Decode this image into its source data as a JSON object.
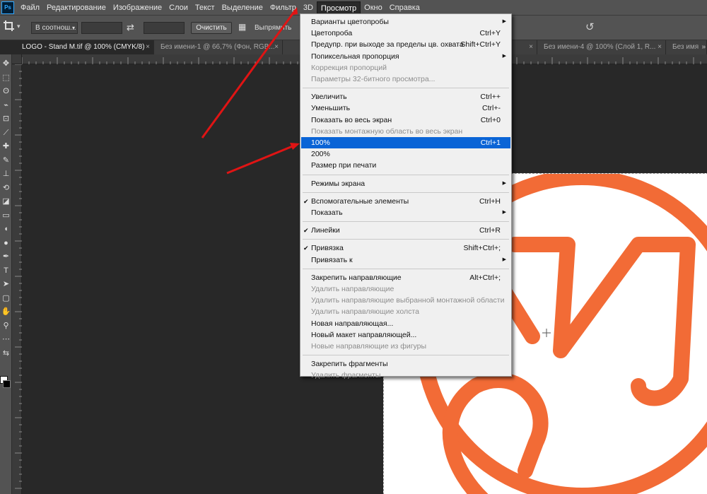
{
  "colors": {
    "menu_highlight": "#0a64d6",
    "logo_orange": "#f26b36",
    "annotation_arrow": "#e01414"
  },
  "menubar": {
    "app_icon": "Ps",
    "items": [
      "Файл",
      "Редактирование",
      "Изображение",
      "Слои",
      "Текст",
      "Выделение",
      "Фильтр",
      "3D",
      "Просмотр",
      "Окно",
      "Справка"
    ],
    "active_index": 8
  },
  "options_bar": {
    "tool_icon": "crop-icon",
    "ratio_value": "В соотнош...",
    "width_value": "",
    "height_value": "",
    "clear_label": "Очистить",
    "straighten_label": "Выпрямить",
    "reset_icon": "reset-icon"
  },
  "tabs": [
    {
      "label": "LOGO - Stand M.tif @ 100% (CMYK/8)",
      "active": true
    },
    {
      "label": "Без имени-1 @ 66,7% (Фон, RGB...",
      "active": false
    },
    {
      "label": "",
      "active": false
    },
    {
      "label": "",
      "active": false
    },
    {
      "label": "Без имени-4 @ 100% (Слой 1, R...",
      "active": false
    },
    {
      "label": "Без имя",
      "active": false
    }
  ],
  "tabs_scroll_icon": "double-chevron-right-icon",
  "view_menu": {
    "groups": [
      [
        {
          "label": "Варианты цветопробы",
          "shortcut": "",
          "submenu": true,
          "disabled": false,
          "checked": false
        },
        {
          "label": "Цветопроба",
          "shortcut": "Ctrl+Y",
          "submenu": false,
          "disabled": false,
          "checked": false
        },
        {
          "label": "Предупр. при выходе за пределы цв. охвата",
          "shortcut": "Shift+Ctrl+Y",
          "submenu": false,
          "disabled": false,
          "checked": false
        },
        {
          "label": "Попиксельная пропорция",
          "shortcut": "",
          "submenu": true,
          "disabled": false,
          "checked": false
        },
        {
          "label": "Коррекция пропорций",
          "shortcut": "",
          "submenu": false,
          "disabled": true,
          "checked": false
        },
        {
          "label": "Параметры 32-битного просмотра...",
          "shortcut": "",
          "submenu": false,
          "disabled": true,
          "checked": false
        }
      ],
      [
        {
          "label": "Увеличить",
          "shortcut": "Ctrl++",
          "submenu": false,
          "disabled": false,
          "checked": false
        },
        {
          "label": "Уменьшить",
          "shortcut": "Ctrl+-",
          "submenu": false,
          "disabled": false,
          "checked": false
        },
        {
          "label": "Показать во весь экран",
          "shortcut": "Ctrl+0",
          "submenu": false,
          "disabled": false,
          "checked": false
        },
        {
          "label": "Показать монтажную область во весь экран",
          "shortcut": "",
          "submenu": false,
          "disabled": true,
          "checked": false
        },
        {
          "label": "100%",
          "shortcut": "Ctrl+1",
          "submenu": false,
          "disabled": false,
          "checked": false,
          "highlighted": true
        },
        {
          "label": "200%",
          "shortcut": "",
          "submenu": false,
          "disabled": false,
          "checked": false
        },
        {
          "label": "Размер при печати",
          "shortcut": "",
          "submenu": false,
          "disabled": false,
          "checked": false
        }
      ],
      [
        {
          "label": "Режимы экрана",
          "shortcut": "",
          "submenu": true,
          "disabled": false,
          "checked": false
        }
      ],
      [
        {
          "label": "Вспомогательные элементы",
          "shortcut": "Ctrl+H",
          "submenu": false,
          "disabled": false,
          "checked": true
        },
        {
          "label": "Показать",
          "shortcut": "",
          "submenu": true,
          "disabled": false,
          "checked": false
        }
      ],
      [
        {
          "label": "Линейки",
          "shortcut": "Ctrl+R",
          "submenu": false,
          "disabled": false,
          "checked": true
        }
      ],
      [
        {
          "label": "Привязка",
          "shortcut": "Shift+Ctrl+;",
          "submenu": false,
          "disabled": false,
          "checked": true
        },
        {
          "label": "Привязать к",
          "shortcut": "",
          "submenu": true,
          "disabled": false,
          "checked": false
        }
      ],
      [
        {
          "label": "Закрепить направляющие",
          "shortcut": "Alt+Ctrl+;",
          "submenu": false,
          "disabled": false,
          "checked": false
        },
        {
          "label": "Удалить направляющие",
          "shortcut": "",
          "submenu": false,
          "disabled": true,
          "checked": false
        },
        {
          "label": "Удалить направляющие выбранной монтажной области",
          "shortcut": "",
          "submenu": false,
          "disabled": true,
          "checked": false
        },
        {
          "label": "Удалить направляющие холста",
          "shortcut": "",
          "submenu": false,
          "disabled": true,
          "checked": false
        },
        {
          "label": "Новая направляющая...",
          "shortcut": "",
          "submenu": false,
          "disabled": false,
          "checked": false
        },
        {
          "label": "Новый макет направляющей...",
          "shortcut": "",
          "submenu": false,
          "disabled": false,
          "checked": false
        },
        {
          "label": "Новые направляющие из фигуры",
          "shortcut": "",
          "submenu": false,
          "disabled": true,
          "checked": false
        }
      ],
      [
        {
          "label": "Закрепить фрагменты",
          "shortcut": "",
          "submenu": false,
          "disabled": false,
          "checked": false
        },
        {
          "label": "Удалить фрагменты",
          "shortcut": "",
          "submenu": false,
          "disabled": true,
          "checked": false
        }
      ]
    ]
  },
  "toolbar_icons": [
    "move-icon",
    "marquee-icon",
    "lasso-icon",
    "quick-select-icon",
    "crop-icon",
    "eyedropper-icon",
    "healing-icon",
    "brush-icon",
    "clone-stamp-icon",
    "history-brush-icon",
    "eraser-icon",
    "gradient-icon",
    "blur-icon",
    "dodge-icon",
    "pen-icon",
    "type-icon",
    "path-select-icon",
    "shape-icon",
    "hand-icon",
    "zoom-icon",
    "more-icon",
    "swap-colors-icon"
  ]
}
